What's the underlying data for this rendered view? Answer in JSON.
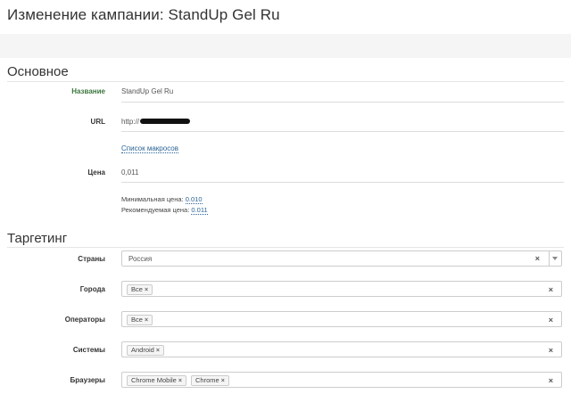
{
  "page": {
    "title": "Изменение кампании: StandUp Gel Ru"
  },
  "basic": {
    "section_title": "Основное",
    "name_label": "Название",
    "name_value": "StandUp Gel Ru",
    "url_label": "URL",
    "url_value": "http://",
    "macros_link": "Список макросов",
    "price_label": "Цена",
    "price_value": "0,011",
    "min_price_label": "Минимальная цена:",
    "min_price_value": "0.010",
    "rec_price_label": "Рекомендуемая цена:",
    "rec_price_value": "0.011"
  },
  "targeting": {
    "section_title": "Таргетинг",
    "clear_glyph": "×",
    "countries": {
      "label": "Страны",
      "value": "Россия"
    },
    "cities": {
      "label": "Города",
      "tags": [
        "Все"
      ]
    },
    "operators": {
      "label": "Операторы",
      "tags": [
        "Все"
      ]
    },
    "systems": {
      "label": "Системы",
      "tags": [
        "Android"
      ]
    },
    "browsers": {
      "label": "Браузеры",
      "tags": [
        "Chrome Mobile",
        "Chrome"
      ]
    }
  }
}
